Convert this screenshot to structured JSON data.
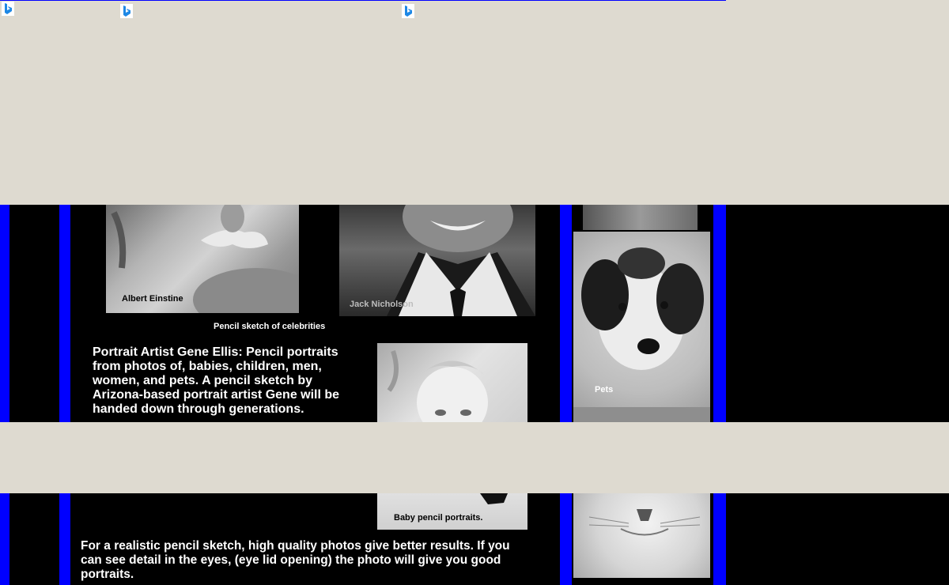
{
  "captions": {
    "einstein": "Albert Einstine",
    "nicholson": "Jack Nicholson",
    "celebrities": "Pencil sketch of celebrities",
    "pets": "Pets",
    "baby": "Baby pencil portraits."
  },
  "intro_text": "Portrait Artist Gene Ellis: Pencil portraits from photos of, babies, children, men, women, and pets. A pencil sketch by Arizona-based portrait artist Gene will be handed down through generations.",
  "photo_tip_text": "For a realistic pencil sketch, high quality photos give better results. If you can see detail in the eyes, (eye lid opening) the photo will give you good portraits.",
  "icons": [
    "bing-icon",
    "bing-icon",
    "bing-icon"
  ],
  "colors": {
    "background": "#dedad0",
    "page": "#000000",
    "border": "#0000ff",
    "text": "#ffffff"
  }
}
